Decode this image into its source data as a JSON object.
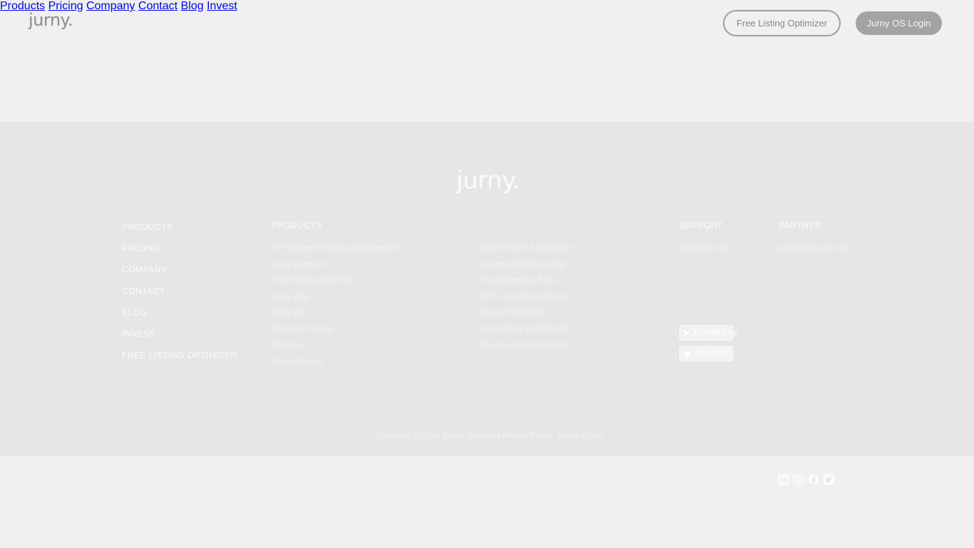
{
  "header": {
    "logo_text": "jurny.",
    "nav": [
      "Products",
      "Pricing",
      "Company",
      "Contact",
      "Blog",
      "Invest"
    ],
    "cta_outline": "Free Listing Optimizer",
    "cta_filled": "Jurny OS Login"
  },
  "footer": {
    "logo_text": "jurny.",
    "links": [
      "PRODUCTS",
      "PRICING",
      "COMPANY",
      "CONTACT",
      "BLOG",
      "INVEST",
      "FREE LISTING OPTIMIZER"
    ],
    "products_heading": "PRODUCTS",
    "products_col1": [
      "AI Powered Property Management",
      "Jurny Connect",
      "Channel Management",
      "Jurny App",
      "Jurny OS",
      "Dynamic Pricing",
      "Reviews",
      "Smart Access"
    ],
    "products_col2": [
      "Smart Home Automation",
      "Automated Messaging",
      "Housekeeping Tools",
      "24/7 Guest Experience",
      "Guest Verification",
      "Accounting and Reports",
      "Revenue Management"
    ],
    "support_heading": "SUPPORT",
    "support_email": "hi@jurny.com",
    "partner_heading": "PARTNER",
    "partner_email": "partner@jurny.com",
    "google_play": "Google Play",
    "app_store": "App Store",
    "social_icons": [
      "linkedin-icon",
      "instagram-icon",
      "facebook-icon",
      "twitter-icon"
    ],
    "copyright": "Copyright 2023 All Rights Reserved",
    "privacy": "Privacy Policy",
    "terms": "Terms of Use"
  }
}
